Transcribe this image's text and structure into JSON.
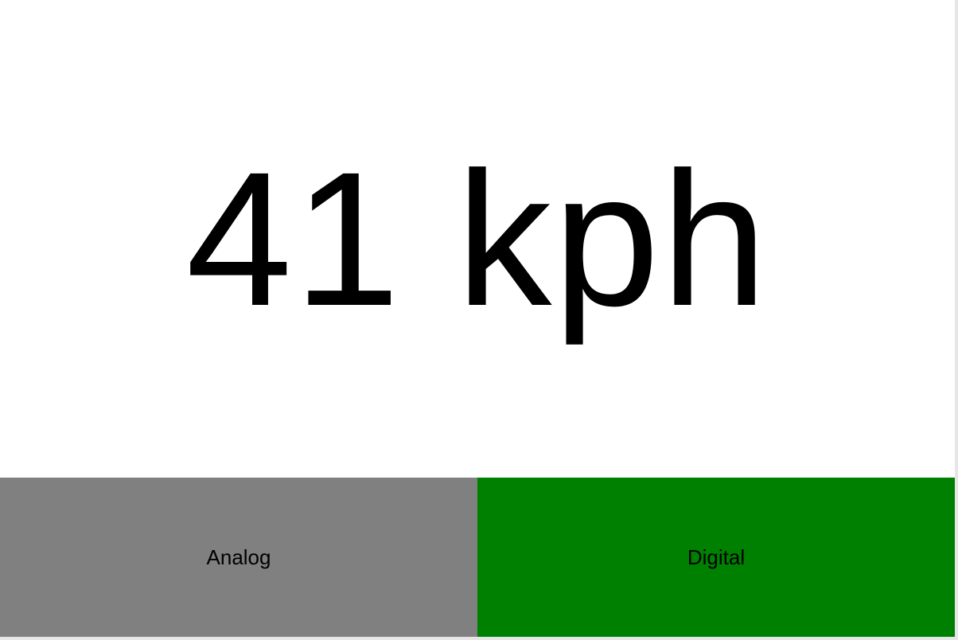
{
  "speedometer": {
    "readout": "41 kph"
  },
  "modes": {
    "analog": {
      "label": "Analog",
      "color": "#808080",
      "selected": false
    },
    "digital": {
      "label": "Digital",
      "color": "#008000",
      "selected": true
    }
  }
}
